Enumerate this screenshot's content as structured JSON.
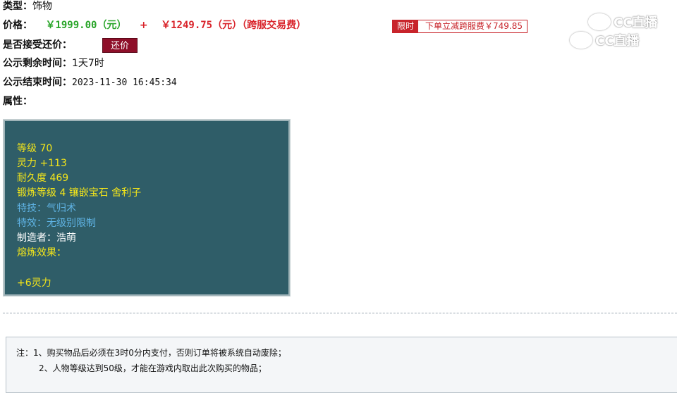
{
  "item": {
    "type_label": "类型：",
    "type_value": "饰物",
    "price_label": "价格：",
    "price_main": "￥1999.00（元）",
    "price_plus": "+",
    "price_cross": "￥1249.75（元）（跨服交易费）",
    "limit_tag": "限时",
    "limit_text": "下单立减跨服费￥749.85",
    "accept_counter_label": "是否接受还价：",
    "counter_button": "还价",
    "remaining_label": "公示剩余时间：",
    "remaining_value": "1天7时",
    "end_label": "公示结束时间：",
    "end_value": "2023-11-30 16:45:34",
    "attr_label": "属性："
  },
  "attributes": {
    "level": "等级 70",
    "spirit": "灵力 +113",
    "durability": "耐久度 469",
    "forge": "锻炼等级 4 镶嵌宝石 舍利子",
    "skill": "特技：气归术",
    "effect": "特效：无级别限制",
    "maker": "制造者：浩萌",
    "melt_label": "熔炼效果：",
    "melt_value": "+6灵力"
  },
  "notes": {
    "line1": "注：1、购买物品后必须在3时0分内支付，否则订单将被系统自动废除；",
    "line2": "2、人物等级达到50级，才能在游戏内取出此次购买的物品；"
  },
  "watermark": {
    "text1": "CC直播",
    "text2": "CC直播"
  },
  "colors": {
    "panel_bg": "#2f5d68",
    "attr_yellow": "#f3e51a",
    "attr_blue": "#5fb3e4",
    "price_green": "#2aa52a",
    "price_red": "#d9242b",
    "button_bg": "#8e0f29"
  }
}
